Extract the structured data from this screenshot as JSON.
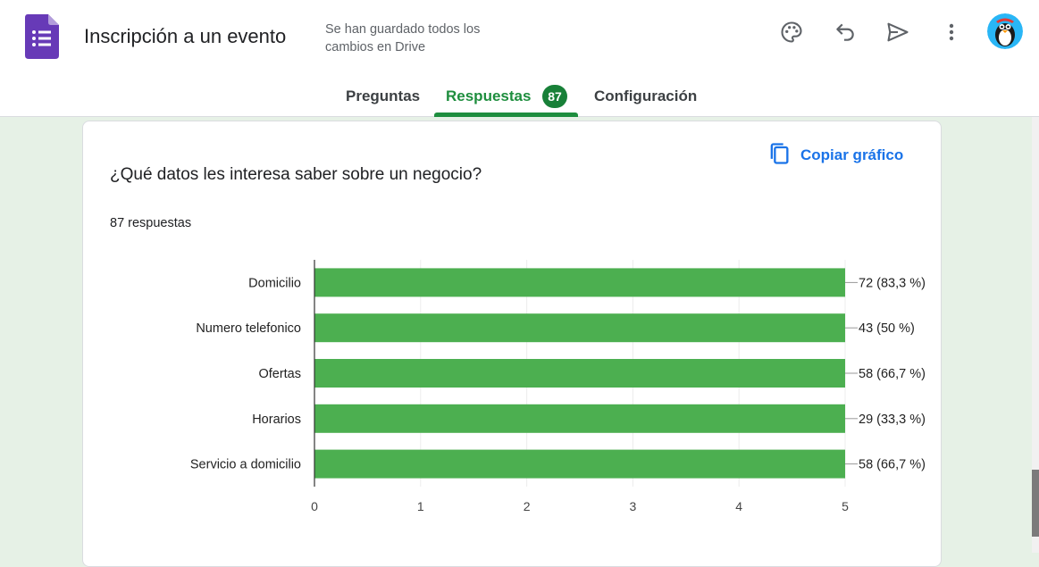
{
  "header": {
    "title": "Inscripción a un evento",
    "save_status": "Se han guardado todos los cambios en Drive",
    "icons": [
      "palette-icon",
      "undo-icon",
      "send-icon",
      "more-vert-icon"
    ]
  },
  "tabs": [
    {
      "label": "Preguntas",
      "active": false
    },
    {
      "label": "Respuestas",
      "active": true,
      "badge": "87"
    },
    {
      "label": "Configuración",
      "active": false
    }
  ],
  "question_card": {
    "question": "¿Qué datos les interesa saber sobre un negocio?",
    "response_count": "87 respuestas",
    "copy_chart_label": "Copiar gráfico"
  },
  "colors": {
    "bar": "#4caf50",
    "accent": "#1e8e3e",
    "link": "#1a73e8",
    "forms_purple": "#673ab7"
  },
  "chart_data": {
    "type": "bar",
    "orientation": "horizontal",
    "categories": [
      "Domicilio",
      "Numero telefonico",
      "Ofertas",
      "Horarios",
      "Servicio a domicilio"
    ],
    "values": [
      72,
      43,
      58,
      29,
      58
    ],
    "data_labels": [
      "72 (83,3 %)",
      "43 (50 %)",
      "58 (66,7 %)",
      "29 (33,3 %)",
      "58 (66,7 %)"
    ],
    "x_ticks": [
      "0",
      "1",
      "2",
      "3",
      "4",
      "5"
    ],
    "xlim": [
      0,
      5
    ],
    "grid": true
  }
}
